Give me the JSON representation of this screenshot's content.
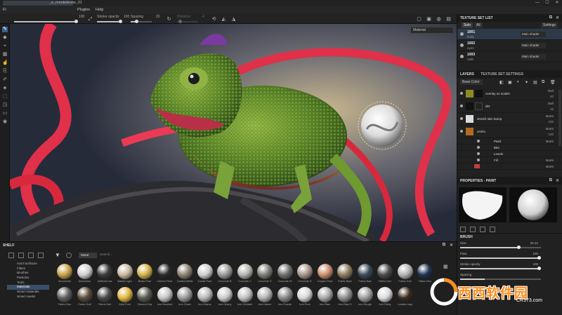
{
  "window": {
    "title": "_e_monteleone_01",
    "controls": [
      "—",
      "☐",
      "✕"
    ]
  },
  "menu": {
    "items": [
      {
        "label": "Fi",
        "x_hint": "start"
      },
      {
        "label": "Plugins"
      },
      {
        "label": "Help"
      }
    ]
  },
  "tool_options": {
    "size_value": "100",
    "stroke_opacity_label": "Stroke opacity",
    "stroke_opacity_value": "100",
    "spacing_label": "Spacing",
    "spacing_value": "20",
    "distance_label": "Distance",
    "distance_value": "4"
  },
  "viewport": {
    "mode": "Material"
  },
  "texture_set_list": {
    "header": "TEXTURE SET LIST",
    "filters": [
      "Solo",
      "All"
    ],
    "settings_label": "Settings",
    "items": [
      {
        "name": "1001",
        "sub": "body",
        "shader": "Main shader",
        "selected": true
      },
      {
        "name": "1002",
        "sub": "eyes",
        "shader": "Main shader",
        "selected": false
      },
      {
        "name": "1003",
        "sub": "nails",
        "shader": "Main shader",
        "selected": false
      }
    ]
  },
  "layers": {
    "tab_layers": "LAYERS",
    "tab_texture_set_settings": "TEXTURE SET SETTINGS",
    "channel": "Base Color",
    "items": [
      {
        "name": "overlay on scales",
        "blend": "Ovrl",
        "opacity": "30",
        "thumb": "#8a8a20",
        "thumb2": "#111"
      },
      {
        "name": "dirt",
        "blend": "Ovrl",
        "opacity": "15",
        "thumb": "#111",
        "thumb2": "#111"
      },
      {
        "name": "stretch skin bump",
        "blend": "Norm",
        "opacity": "100",
        "thumb": "#ddd",
        "thumb2": ""
      },
      {
        "name": "venitu",
        "blend": "Norm",
        "opacity": "100",
        "thumb": "#b06a20",
        "thumb2": ""
      }
    ],
    "effects": [
      {
        "name": "Paint",
        "blend": "Norm",
        "opacity": "100"
      },
      {
        "name": "Blur",
        "blend": "",
        "opacity": ""
      },
      {
        "name": "Levels",
        "blend": "",
        "opacity": ""
      },
      {
        "name": "Fill",
        "blend": "Norm",
        "opacity": "100"
      }
    ],
    "last_blend": "Norm"
  },
  "properties": {
    "header": "PROPERTIES - PAINT",
    "brush_label": "BRUSH",
    "rows": [
      {
        "label": "Size",
        "value": "20.21",
        "fill": 0.72
      },
      {
        "label": "Flow",
        "value": "100",
        "fill": 1.0
      },
      {
        "label": "Stroke opacity",
        "value": "100",
        "fill": 1.0
      },
      {
        "label": "Spacing",
        "value": "",
        "fill": 0.3
      }
    ]
  },
  "shelf": {
    "header": "SHELF",
    "filter_chip": "Metal",
    "search_placeholder": "Search...",
    "categories": [
      "Hard Surfaces",
      "Filters",
      "Brushes",
      "Particles",
      "Tools",
      "Materials",
      "Smart materials",
      "Smart masks"
    ],
    "selected_category": "Materials",
    "row1": [
      {
        "name": "Aluminium",
        "color": "#c8a24a"
      },
      {
        "name": "Aluminium",
        "color": "#d0d0d0"
      },
      {
        "name": "Artificial Lea",
        "color": "#3a3a3a"
      },
      {
        "name": "Baked Light",
        "color": "#c9b9a0"
      },
      {
        "name": "Brass Pure",
        "color": "#d4b24a"
      },
      {
        "name": "Carbon Fiber",
        "color": "#2a2a2a"
      },
      {
        "name": "Coated Metal",
        "color": "#8c8270"
      },
      {
        "name": "Cobalt Pure",
        "color": "#cfcfcf"
      },
      {
        "name": "Concrete B",
        "color": "#9a9a96"
      },
      {
        "name": "Concrete C",
        "color": "#b4b4b0"
      },
      {
        "name": "Concrete D",
        "color": "#7d7e78"
      },
      {
        "name": "Concrete Sl",
        "color": "#6e706a"
      },
      {
        "name": "Concrete S",
        "color": "#a7958a"
      },
      {
        "name": "Copper Pure",
        "color": "#c98c6a"
      },
      {
        "name": "Fabric Bam",
        "color": "#8c7c5e"
      },
      {
        "name": "Fabric Bas",
        "color": "#3a4a5a"
      },
      {
        "name": "Fabric Den",
        "color": "#4a4a4c"
      },
      {
        "name": "Fabric Knit",
        "color": "#b5b5b5"
      },
      {
        "name": "Fabric Rou",
        "color": "#1f3350"
      }
    ],
    "row2": [
      {
        "name": "Fabric Rou",
        "color": "#5e5e5e"
      },
      {
        "name": "Fabric Soft",
        "color": "#5a4a3a"
      },
      {
        "name": "Fabric Suit",
        "color": "#4a4a4a"
      },
      {
        "name": "Gold Pure",
        "color": "#e0b440"
      },
      {
        "name": "Ground Gra",
        "color": "#5a5a50"
      },
      {
        "name": "Iron Brushed",
        "color": "#c4c4c4"
      },
      {
        "name": "Iron Chain",
        "color": "#9a9a9a"
      },
      {
        "name": "Iron Diamo",
        "color": "#b8b8b8"
      },
      {
        "name": "Iron Grainy",
        "color": "#cacaca"
      },
      {
        "name": "Iron Grinded",
        "color": "#c0c0c0"
      },
      {
        "name": "Iron Hamm",
        "color": "#b2b2b2"
      },
      {
        "name": "Iron Powde",
        "color": "#8a8a8a"
      },
      {
        "name": "Iron Pure",
        "color": "#d6d6d6"
      },
      {
        "name": "Iron Raw",
        "color": "#a8a8a8"
      },
      {
        "name": "Iron Raw D",
        "color": "#8e8e8e"
      },
      {
        "name": "Iron Rough",
        "color": "#9e9e9e"
      },
      {
        "name": "Iron Shiny",
        "color": "#dadada"
      },
      {
        "name": "Leather bag",
        "color": "#3a2a20"
      }
    ]
  },
  "watermark": {
    "text": "西西软件园",
    "url": "CR173.com",
    "color": "#ff8c1a"
  }
}
